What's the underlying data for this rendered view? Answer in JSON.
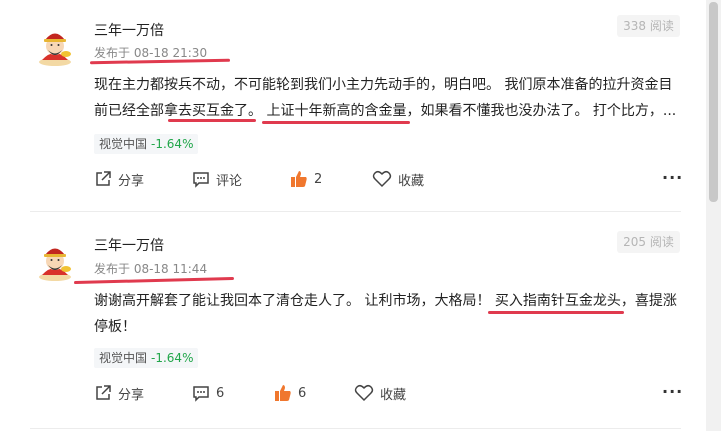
{
  "posts": [
    {
      "author": "三年一万倍",
      "time": "发布于 08-18 21:30",
      "reads": "338 阅读",
      "content_line1": "现在主力都按兵不动，不可能轮到我们小主力先动手的，明白吧。 我们原本准备的拉升资金目",
      "content_line2": "前已经全部拿去买互金了。 上证十年新高的含金量，如果看不懂我也没办法了。 打个比方，...",
      "tag_name": "视觉中国",
      "tag_change": "-1.64%",
      "share_label": "分享",
      "comment_label": "评论",
      "like_count": "2",
      "collect_label": "收藏"
    },
    {
      "author": "三年一万倍",
      "time": "发布于 08-18 11:44",
      "reads": "205 阅读",
      "content_line1": "谢谢高开解套了能让我回本了清仓走人了。 让利市场，大格局！ 买入指南针互金龙头，喜提涨",
      "content_line2": "停板！",
      "tag_name": "视觉中国",
      "tag_change": "-1.64%",
      "share_label": "分享",
      "comment_count": "6",
      "like_count": "6",
      "collect_label": "收藏"
    }
  ],
  "colors": {
    "annotation": "#e03a4e",
    "positive": "#21a64a",
    "like": "#f0772e"
  },
  "icons": [
    "avatar",
    "share-icon",
    "comment-icon",
    "like-icon",
    "collect-icon",
    "more-icon"
  ]
}
